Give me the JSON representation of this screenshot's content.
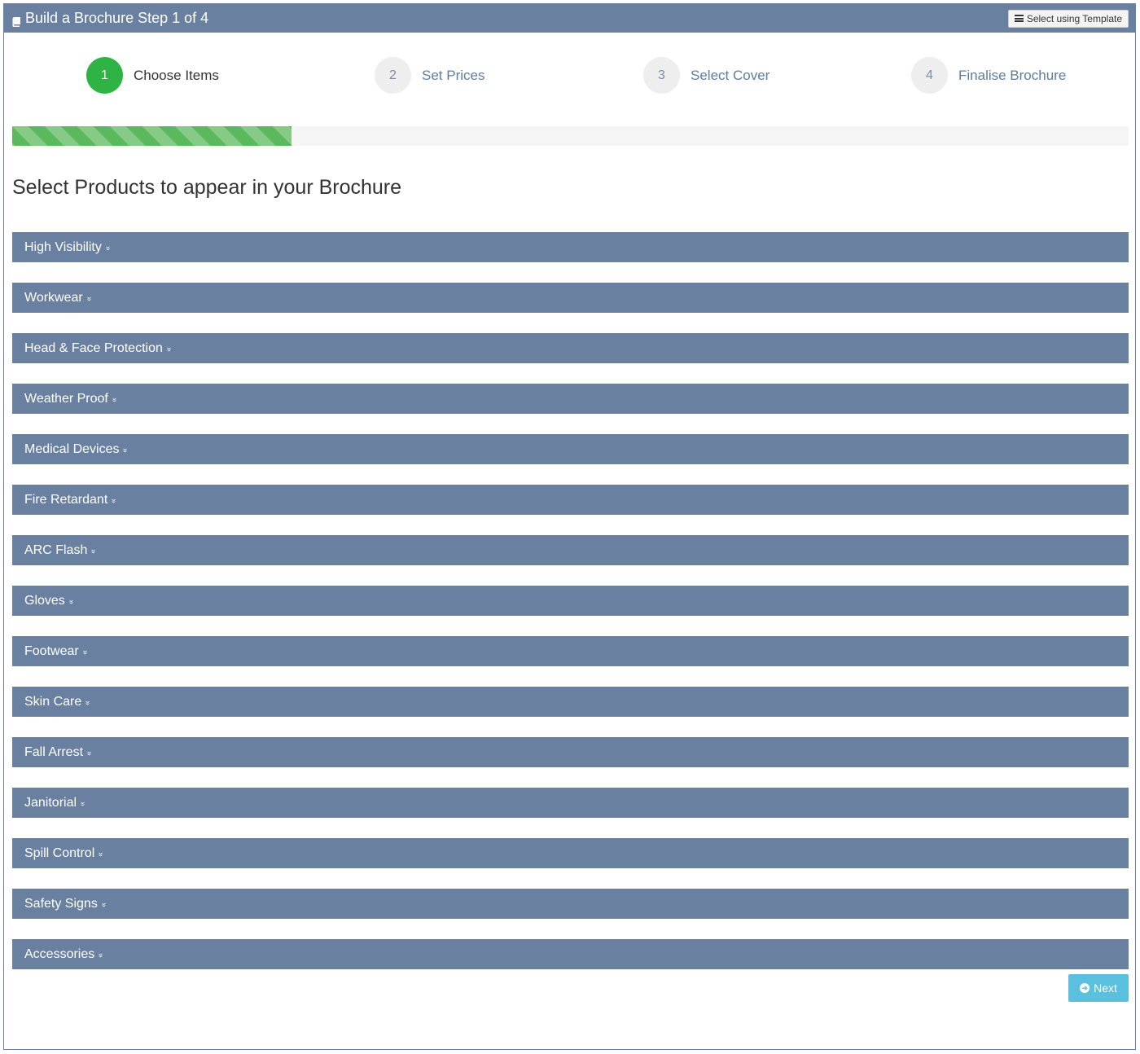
{
  "header": {
    "title": "Build a Brochure Step 1 of 4",
    "template_button": "Select using Template"
  },
  "steps": [
    {
      "number": "1",
      "label": "Choose Items",
      "active": true
    },
    {
      "number": "2",
      "label": "Set Prices",
      "active": false
    },
    {
      "number": "3",
      "label": "Select Cover",
      "active": false
    },
    {
      "number": "4",
      "label": "Finalise Brochure",
      "active": false
    }
  ],
  "progress": {
    "percent": 25,
    "color": "#5cb85c"
  },
  "heading": "Select Products to appear in your Brochure",
  "categories": [
    "High Visibility",
    "Workwear",
    "Head & Face Protection",
    "Weather Proof",
    "Medical Devices",
    "Fire Retardant",
    "ARC Flash",
    "Gloves",
    "Footwear",
    "Skin Care",
    "Fall Arrest",
    "Janitorial",
    "Spill Control",
    "Safety Signs",
    "Accessories"
  ],
  "next_button": "Next",
  "icons": {
    "title": "book-icon",
    "template": "list-icon",
    "category": "double-chevron-down-icon",
    "next": "arrow-circle-right-icon"
  },
  "colors": {
    "header": "#6980a0",
    "active_step": "#2fb344",
    "next_button": "#5bc0de"
  }
}
